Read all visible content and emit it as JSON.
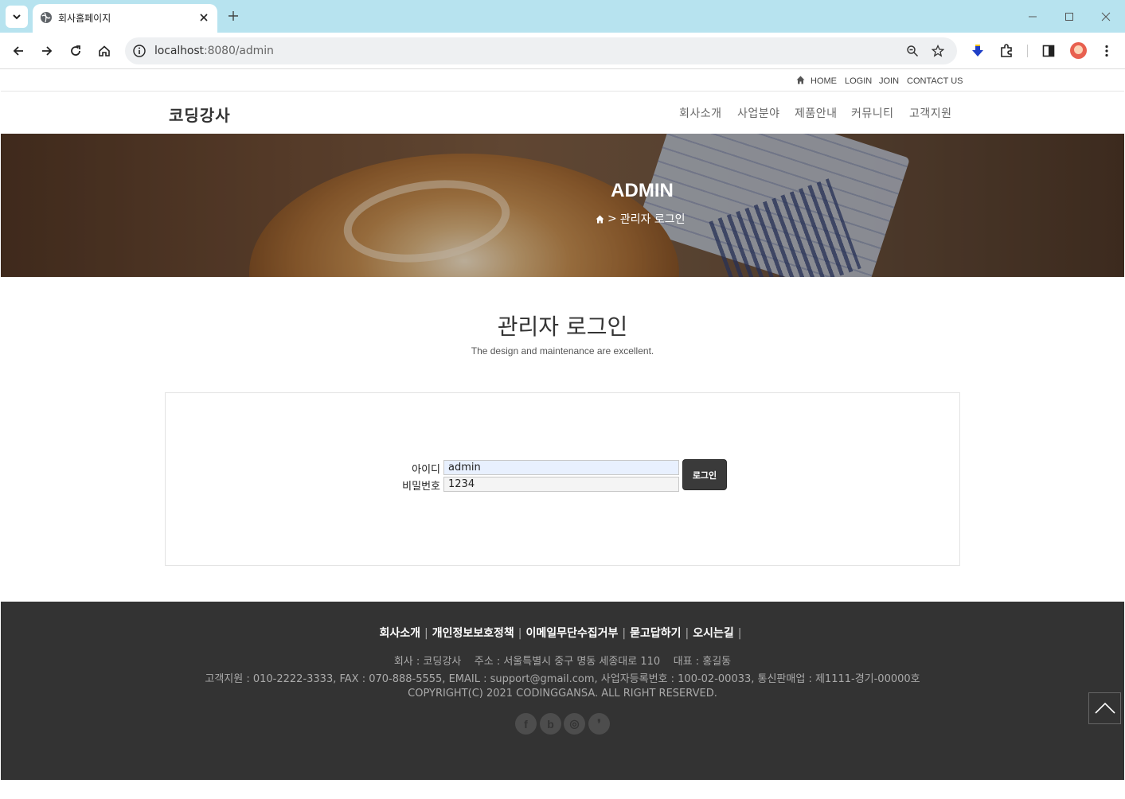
{
  "browser": {
    "tab_title": "회사홈페이지",
    "url_host": "localhost",
    "url_rest": ":8080/admin"
  },
  "util_nav": {
    "items": [
      "HOME",
      "LOGIN",
      "JOIN",
      "CONTACT US"
    ]
  },
  "header": {
    "logo": "코딩강사",
    "menu": [
      "회사소개",
      "사업분야",
      "제품안내",
      "커뮤니티",
      "고객지원"
    ]
  },
  "hero": {
    "title": "ADMIN",
    "breadcrumb_sep": ">",
    "breadcrumb": "관리자 로그인"
  },
  "content": {
    "title": "관리자 로그인",
    "subtitle": "The design and maintenance are excellent."
  },
  "login_form": {
    "id_label": "아이디",
    "id_value": "admin",
    "pw_label": "비밀번호",
    "pw_value": "1234",
    "submit_label": "로그인"
  },
  "footer": {
    "links": [
      "회사소개",
      "개인정보보호정책",
      "이메일무단수집거부",
      "묻고답하기",
      "오시는길"
    ],
    "line1": "회사 : 코딩강사    주소 : 서울특별시 중구 명동 세종대로 110    대표 : 홍길동",
    "line2": "고객지원 : 010-2222-3333, FAX : 070-888-5555, EMAIL : support@gmail.com, 사업자등록번호 : 100-02-00033, 통신판매업 : 제1111-경기-00000호",
    "line3": "COPYRIGHT(C) 2021 CODINGGANSA. ALL RIGHT RESERVED.",
    "sns": [
      "f",
      "b",
      "◎",
      "❜"
    ]
  }
}
